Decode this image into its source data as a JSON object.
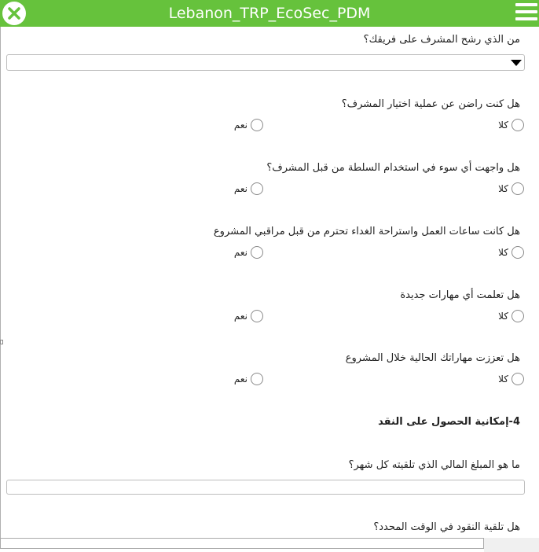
{
  "app": {
    "title": "Lebanon_TRP_EcoSec_PDM"
  },
  "colors": {
    "header_bg": "#66c23c",
    "header_text": "#ffffff"
  },
  "icons": {
    "close": "close-icon",
    "menu": "hamburger-menu-icon",
    "dropdown": "caret-down-icon"
  },
  "form": {
    "q_supervisor": {
      "label": "من الذي رشح المشرف على فريقك؟",
      "value": ""
    },
    "questions": [
      {
        "label": "هل كنت راضن عن عملية اختيار المشرف؟",
        "no": "كلا",
        "yes": "نعم"
      },
      {
        "label": "هل واجهت أي سوء في استخدام السلطة من قبل المشرف؟",
        "no": "كلا",
        "yes": "نعم"
      },
      {
        "label": "هل كانت ساعات العمل واستراحة الغداء تحترم من قبل مراقبي المشروع",
        "no": "كلا",
        "yes": "نعم"
      },
      {
        "label": "هل تعلمت أي مهارات جديدة",
        "no": "كلا",
        "yes": "نعم"
      },
      {
        "label": "هل تعززت مهاراتك الحالية خلال المشروع",
        "no": "كلا",
        "yes": "نعم"
      }
    ],
    "section_cash": "4-إمكانية الحصول على النقد",
    "q_amount": {
      "label": "ما هو المبلغ المالي الذي تلقيته كل شهر؟",
      "value": ""
    },
    "q_ontime": {
      "label": "هل تلقية النقود في الوقت المحدد؟"
    }
  }
}
